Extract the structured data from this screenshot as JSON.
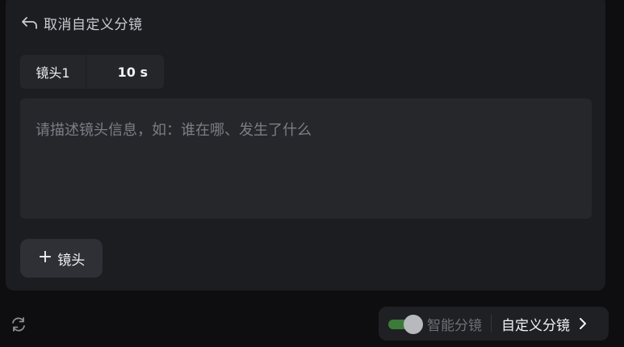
{
  "header": {
    "back_icon": "return-arrow-icon",
    "back_label": "取消自定义分镜"
  },
  "shot": {
    "name": "镜头1",
    "duration": "10 s"
  },
  "description": {
    "value": "",
    "placeholder": "请描述镜头信息，如：谁在哪、发生了什么"
  },
  "add_shot": {
    "icon": "plus-icon",
    "label": "镜头"
  },
  "footer": {
    "refresh_icon": "refresh-icon",
    "smart_split_label": "智能分镜",
    "smart_split_enabled": true,
    "custom_split_label": "自定义分镜",
    "chevron_icon": "chevron-right-icon"
  },
  "colors": {
    "background": "#0e0e10",
    "panel": "#1c1d20",
    "toggle_track": "#3c7a3a",
    "text_primary": "#f0f1f4",
    "text_muted": "#7c7e85"
  }
}
